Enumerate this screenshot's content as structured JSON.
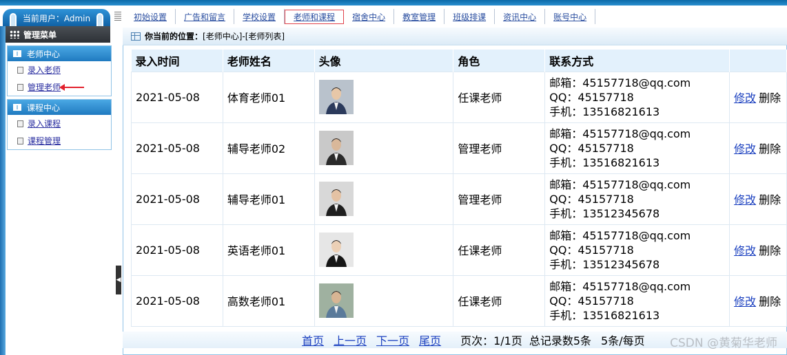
{
  "header": {
    "user_label": "当前用户：Admin"
  },
  "nav": {
    "items": [
      {
        "label": "初始设置"
      },
      {
        "label": "广告和留言"
      },
      {
        "label": "学校设置"
      },
      {
        "label": "老师和课程",
        "active": true
      },
      {
        "label": "宿舍中心"
      },
      {
        "label": "教室管理"
      },
      {
        "label": "班级排课"
      },
      {
        "label": "资讯中心"
      },
      {
        "label": "账号中心"
      }
    ]
  },
  "sidebar": {
    "title": "管理菜单",
    "groups": [
      {
        "title": "老师中心",
        "items": [
          {
            "label": "录入老师"
          },
          {
            "label": "管理老师"
          }
        ]
      },
      {
        "title": "课程中心",
        "items": [
          {
            "label": "录入课程"
          },
          {
            "label": "课程管理"
          }
        ]
      }
    ]
  },
  "breadcrumb": {
    "prefix": "你当前的位置：",
    "path": "[老师中心]-[老师列表]"
  },
  "table": {
    "columns": [
      "录入时间",
      "老师姓名",
      "头像",
      "角色",
      "联系方式",
      ""
    ],
    "rows": [
      {
        "date": "2021-05-08",
        "name": "体育老师01",
        "role": "任课老师",
        "email": "邮箱：45157718@qq.com",
        "qq": "QQ：45157718",
        "phone": "手机：13516821613",
        "edit": "修改",
        "delete": "删除",
        "avatar": {
          "bg": "#b9c2cc",
          "suit": "#2b3a5c",
          "skin": "#e7c7a8"
        }
      },
      {
        "date": "2021-05-08",
        "name": "辅导老师02",
        "role": "管理老师",
        "email": "邮箱：45157718@qq.com",
        "qq": "QQ：45157718",
        "phone": "手机：13516821613",
        "edit": "修改",
        "delete": "删除",
        "avatar": {
          "bg": "#c9c9c9",
          "suit": "#2a2a2a",
          "skin": "#d9b89a"
        }
      },
      {
        "date": "2021-05-08",
        "name": "辅导老师01",
        "role": "管理老师",
        "email": "邮箱：45157718@qq.com",
        "qq": "QQ：45157718",
        "phone": "手机：13512345678",
        "edit": "修改",
        "delete": "删除",
        "avatar": {
          "bg": "#d8d8d8",
          "suit": "#1e1e1e",
          "skin": "#e4c2a4"
        }
      },
      {
        "date": "2021-05-08",
        "name": "英语老师01",
        "role": "任课老师",
        "email": "邮箱：45157718@qq.com",
        "qq": "QQ：45157718",
        "phone": "手机：13512345678",
        "edit": "修改",
        "delete": "删除",
        "avatar": {
          "bg": "#e6e6e6",
          "suit": "#151515",
          "skin": "#ecd0b6"
        }
      },
      {
        "date": "2021-05-08",
        "name": "高数老师01",
        "role": "任课老师",
        "email": "邮箱：45157718@qq.com",
        "qq": "QQ：45157718",
        "phone": "手机：13516821613",
        "edit": "修改",
        "delete": "删除",
        "avatar": {
          "bg": "#9fb1a0",
          "suit": "#5a7a9a",
          "skin": "#d7b594"
        }
      }
    ]
  },
  "pager": {
    "first": "首页",
    "prev": "上一页",
    "next": "下一页",
    "last": "尾页",
    "page_info": "页次：1/1页",
    "total": "总记录数5条",
    "per_page": "5条/每页"
  },
  "watermark": "CSDN @黄菊华老师",
  "splitter_glyph": "◀"
}
